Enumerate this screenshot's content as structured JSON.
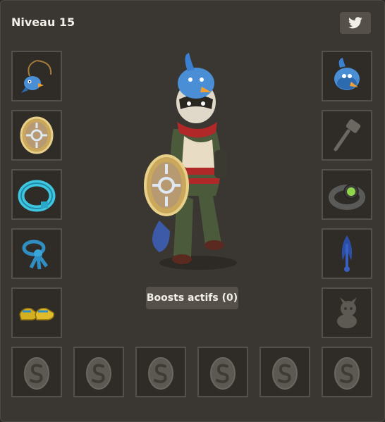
{
  "header": {
    "level_label": "Niveau 15"
  },
  "actions": {
    "boosts_label": "Boosts actifs (0)"
  },
  "colors": {
    "panel_bg": "#3a3631",
    "slot_border": "#55504a",
    "text": "#f2efe9"
  },
  "equipment": {
    "left": [
      {
        "slot": "amulet",
        "icon": "bird-amulet-icon",
        "empty": false
      },
      {
        "slot": "shield",
        "icon": "shield-icon",
        "empty": false
      },
      {
        "slot": "ring",
        "icon": "cyan-ring-icon",
        "empty": false
      },
      {
        "slot": "belt",
        "icon": "belt-icon",
        "empty": false
      },
      {
        "slot": "boots",
        "icon": "boots-icon",
        "empty": false
      }
    ],
    "right": [
      {
        "slot": "hat",
        "icon": "bird-hat-icon",
        "empty": false
      },
      {
        "slot": "weapon",
        "icon": "hammer-icon",
        "empty": true
      },
      {
        "slot": "ring",
        "icon": "dark-ring-icon",
        "empty": false
      },
      {
        "slot": "cape",
        "icon": "feather-cape-icon",
        "empty": false
      },
      {
        "slot": "pet",
        "icon": "pet-icon",
        "empty": true
      }
    ],
    "dofus": [
      {
        "slot": "dofus-1",
        "icon": "dofus-egg-icon",
        "empty": true
      },
      {
        "slot": "dofus-2",
        "icon": "dofus-egg-icon",
        "empty": true
      },
      {
        "slot": "dofus-3",
        "icon": "dofus-egg-icon",
        "empty": true
      },
      {
        "slot": "dofus-4",
        "icon": "dofus-egg-icon",
        "empty": true
      },
      {
        "slot": "dofus-5",
        "icon": "dofus-egg-icon",
        "empty": true
      },
      {
        "slot": "dofus-6",
        "icon": "dofus-egg-icon",
        "empty": true
      }
    ]
  }
}
